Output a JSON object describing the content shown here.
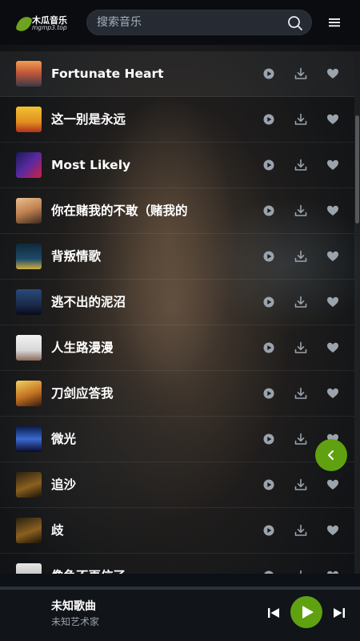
{
  "app": {
    "logo_title": "木瓜音乐",
    "logo_sub": "mgmp3.top"
  },
  "search": {
    "placeholder": "搜索音乐"
  },
  "icons": {
    "search": "search-icon",
    "menu": "menu-icon",
    "play": "play-circle-icon",
    "download": "download-icon",
    "favorite": "heart-icon",
    "back": "chevron-left-icon"
  },
  "songs": [
    {
      "title": "Fortunate Heart"
    },
    {
      "title": "这一别是永远"
    },
    {
      "title": "Most Likely"
    },
    {
      "title": "你在赌我的不敢（赌我的"
    },
    {
      "title": "背叛情歌"
    },
    {
      "title": "逃不出的泥沼"
    },
    {
      "title": "人生路漫漫"
    },
    {
      "title": "刀剑应答我"
    },
    {
      "title": "微光"
    },
    {
      "title": "追沙"
    },
    {
      "title": "歧"
    },
    {
      "title": "像鱼不再信了"
    }
  ],
  "player": {
    "song_name": "未知歌曲",
    "artist": "未知艺术家",
    "progress": 0
  },
  "colors": {
    "accent": "#5fa111",
    "header_bg": "#0b0c10",
    "player_bg": "#111419"
  }
}
